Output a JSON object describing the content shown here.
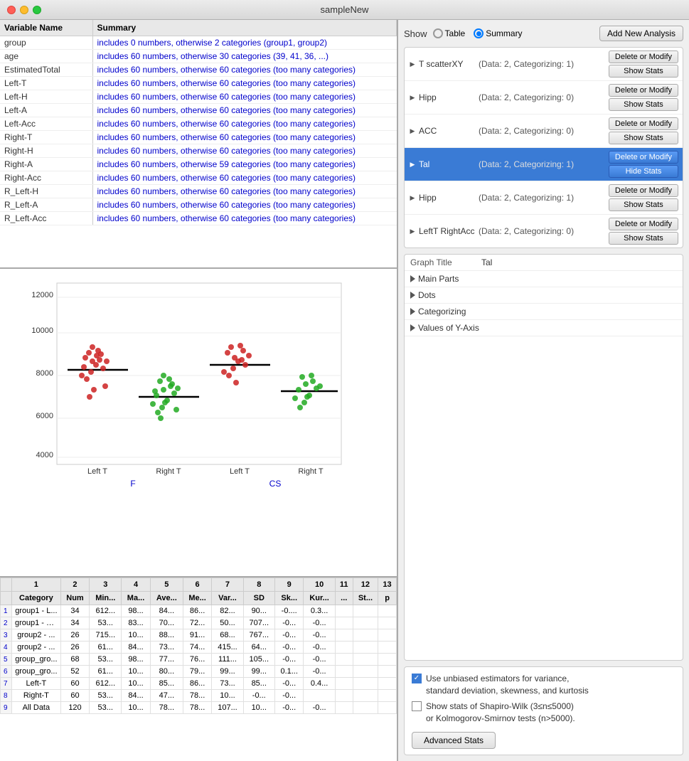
{
  "titleBar": {
    "title": "sampleNew"
  },
  "leftPanel": {
    "varTable": {
      "col1": "Variable Name",
      "col2": "Summary",
      "rows": [
        {
          "name": "group",
          "summary": "includes 0 numbers, otherwise 2 categories (group1, group2)"
        },
        {
          "name": "age",
          "summary": "includes 60 numbers, otherwise 30 categories (39, 41, 36, ...)"
        },
        {
          "name": "EstimatedTotal",
          "summary": "includes 60 numbers, otherwise 60 categories (too many categories)"
        },
        {
          "name": "Left-T",
          "summary": "includes 60 numbers, otherwise 60 categories (too many categories)"
        },
        {
          "name": "Left-H",
          "summary": "includes 60 numbers, otherwise 60 categories (too many categories)"
        },
        {
          "name": "Left-A",
          "summary": "includes 60 numbers, otherwise 60 categories (too many categories)"
        },
        {
          "name": "Left-Acc",
          "summary": "includes 60 numbers, otherwise 60 categories (too many categories)"
        },
        {
          "name": "Right-T",
          "summary": "includes 60 numbers, otherwise 60 categories (too many categories)"
        },
        {
          "name": "Right-H",
          "summary": "includes 60 numbers, otherwise 60 categories (too many categories)"
        },
        {
          "name": "Right-A",
          "summary": "includes 60 numbers, otherwise 59 categories (too many categories)"
        },
        {
          "name": "Right-Acc",
          "summary": "includes 60 numbers, otherwise 60 categories (too many categories)"
        },
        {
          "name": "R_Left-H",
          "summary": "includes 60 numbers, otherwise 60 categories (too many categories)"
        },
        {
          "name": "R_Left-A",
          "summary": "includes 60 numbers, otherwise 60 categories (too many categories)"
        },
        {
          "name": "R_Left-Acc",
          "summary": "includes 60 numbers, otherwise 60 categories (too many categories)"
        }
      ]
    },
    "chart": {
      "yAxisLabels": [
        "12000",
        "10000",
        "8000",
        "6000",
        "4000"
      ],
      "xAxisLabels": [
        "Left T",
        "Right T",
        "Left T",
        "Right T"
      ],
      "groupLabels": [
        "F",
        "CS"
      ]
    },
    "statsTable": {
      "headers": [
        "1",
        "2",
        "3",
        "4",
        "5",
        "6",
        "7",
        "8",
        "9",
        "10",
        "11",
        "12",
        "13"
      ],
      "colNames": [
        "Category",
        "Num",
        "Min...",
        "Ma...",
        "Ave...",
        "Me...",
        "Var...",
        "SD",
        "Sk...",
        "Kur...",
        "...",
        "St...",
        "p"
      ],
      "rows": [
        {
          "rowNum": "1",
          "category": "group1 - L...",
          "n": "34",
          "min": "612...",
          "max": "98...",
          "avg": "84...",
          "med": "86...",
          "var": "82...",
          "sd": "90...",
          "sk": "-0....",
          "ku": "0.3...",
          "c11": "",
          "c12": "",
          "c13": ""
        },
        {
          "rowNum": "2",
          "category": "group1 - R...",
          "n": "34",
          "min": "53...",
          "max": "83...",
          "avg": "70...",
          "med": "72...",
          "var": "50...",
          "sd": "707...",
          "sk": "-0...",
          "ku": "-0...",
          "c11": "",
          "c12": "",
          "c13": ""
        },
        {
          "rowNum": "3",
          "category": "group2 - ...",
          "n": "26",
          "min": "715...",
          "max": "10...",
          "avg": "88...",
          "med": "91...",
          "var": "68...",
          "sd": "767...",
          "sk": "-0...",
          "ku": "-0...",
          "c11": "",
          "c12": "",
          "c13": ""
        },
        {
          "rowNum": "4",
          "category": "group2 - ...",
          "n": "26",
          "min": "61...",
          "max": "84...",
          "avg": "73...",
          "med": "74...",
          "var": "415...",
          "sd": "64...",
          "sk": "-0...",
          "ku": "-0...",
          "c11": "",
          "c12": "",
          "c13": ""
        },
        {
          "rowNum": "5",
          "category": "group_gro...",
          "n": "68",
          "min": "53...",
          "max": "98...",
          "avg": "77...",
          "med": "76...",
          "var": "111...",
          "sd": "105...",
          "sk": "-0...",
          "ku": "-0...",
          "c11": "",
          "c12": "",
          "c13": ""
        },
        {
          "rowNum": "6",
          "category": "group_gro...",
          "n": "52",
          "min": "61...",
          "max": "10...",
          "avg": "80...",
          "med": "79...",
          "var": "99...",
          "sd": "99...",
          "sk": "0.1...",
          "ku": "-0...",
          "c11": "",
          "c12": "",
          "c13": ""
        },
        {
          "rowNum": "7",
          "category": "Left-T",
          "n": "60",
          "min": "612...",
          "max": "10...",
          "avg": "85...",
          "med": "86...",
          "var": "73...",
          "sd": "85...",
          "sk": "-0...",
          "ku": "0.4...",
          "c11": "",
          "c12": "",
          "c13": ""
        },
        {
          "rowNum": "8",
          "category": "Right-T",
          "n": "60",
          "min": "53...",
          "max": "84...",
          "avg": "47...",
          "med": "78...",
          "var": "10...",
          "sd": "-0...",
          "sk": "-0...",
          "ku": "",
          "c11": "",
          "c12": "",
          "c13": ""
        },
        {
          "rowNum": "9",
          "category": "All Data",
          "n": "120",
          "min": "53...",
          "max": "10...",
          "avg": "78...",
          "med": "78...",
          "var": "107...",
          "sd": "10...",
          "sk": "-0...",
          "ku": "-0...",
          "c11": "",
          "c12": "",
          "c13": ""
        }
      ]
    }
  },
  "rightPanel": {
    "show": {
      "label": "Show",
      "options": [
        "Table",
        "Summary"
      ],
      "selected": "Summary",
      "addButtonLabel": "Add New Analysis"
    },
    "analyses": [
      {
        "name": "T scatterXY",
        "info": "(Data: 2, Categorizing: 1)",
        "selected": false
      },
      {
        "name": "Hipp",
        "info": "(Data: 2, Categorizing: 0)",
        "selected": false
      },
      {
        "name": "ACC",
        "info": "(Data: 2, Categorizing: 0)",
        "selected": false
      },
      {
        "name": "Tal",
        "info": "(Data: 2, Categorizing: 1)",
        "selected": true
      },
      {
        "name": "Hipp",
        "info": "(Data: 2, Categorizing: 1)",
        "selected": false
      },
      {
        "name": "LeftT RightAcc",
        "info": "(Data: 2, Categorizing: 0)",
        "selected": false
      }
    ],
    "actionButtons": {
      "deleteOrModify": "Delete or Modify",
      "showStats": "Show Stats",
      "hideStats": "Hide Stats"
    },
    "graphProps": {
      "titleLabel": "Graph Title",
      "titleValue": "Tal",
      "sections": [
        "Main Parts",
        "Dots",
        "Categorizing",
        "Values of Y-Axis"
      ]
    },
    "bottomControls": {
      "checkbox1": {
        "checked": true,
        "label": "Use unbiased estimators for variance,\nstandard deviation, skewness, and kurtosis"
      },
      "checkbox2": {
        "checked": false,
        "label": "Show stats of Shapiro-Wilk (3≤n≤5000)\nor Kolmogorov-Smirnov tests (n>5000)."
      },
      "advancedStatsLabel": "Advanced Stats"
    }
  }
}
